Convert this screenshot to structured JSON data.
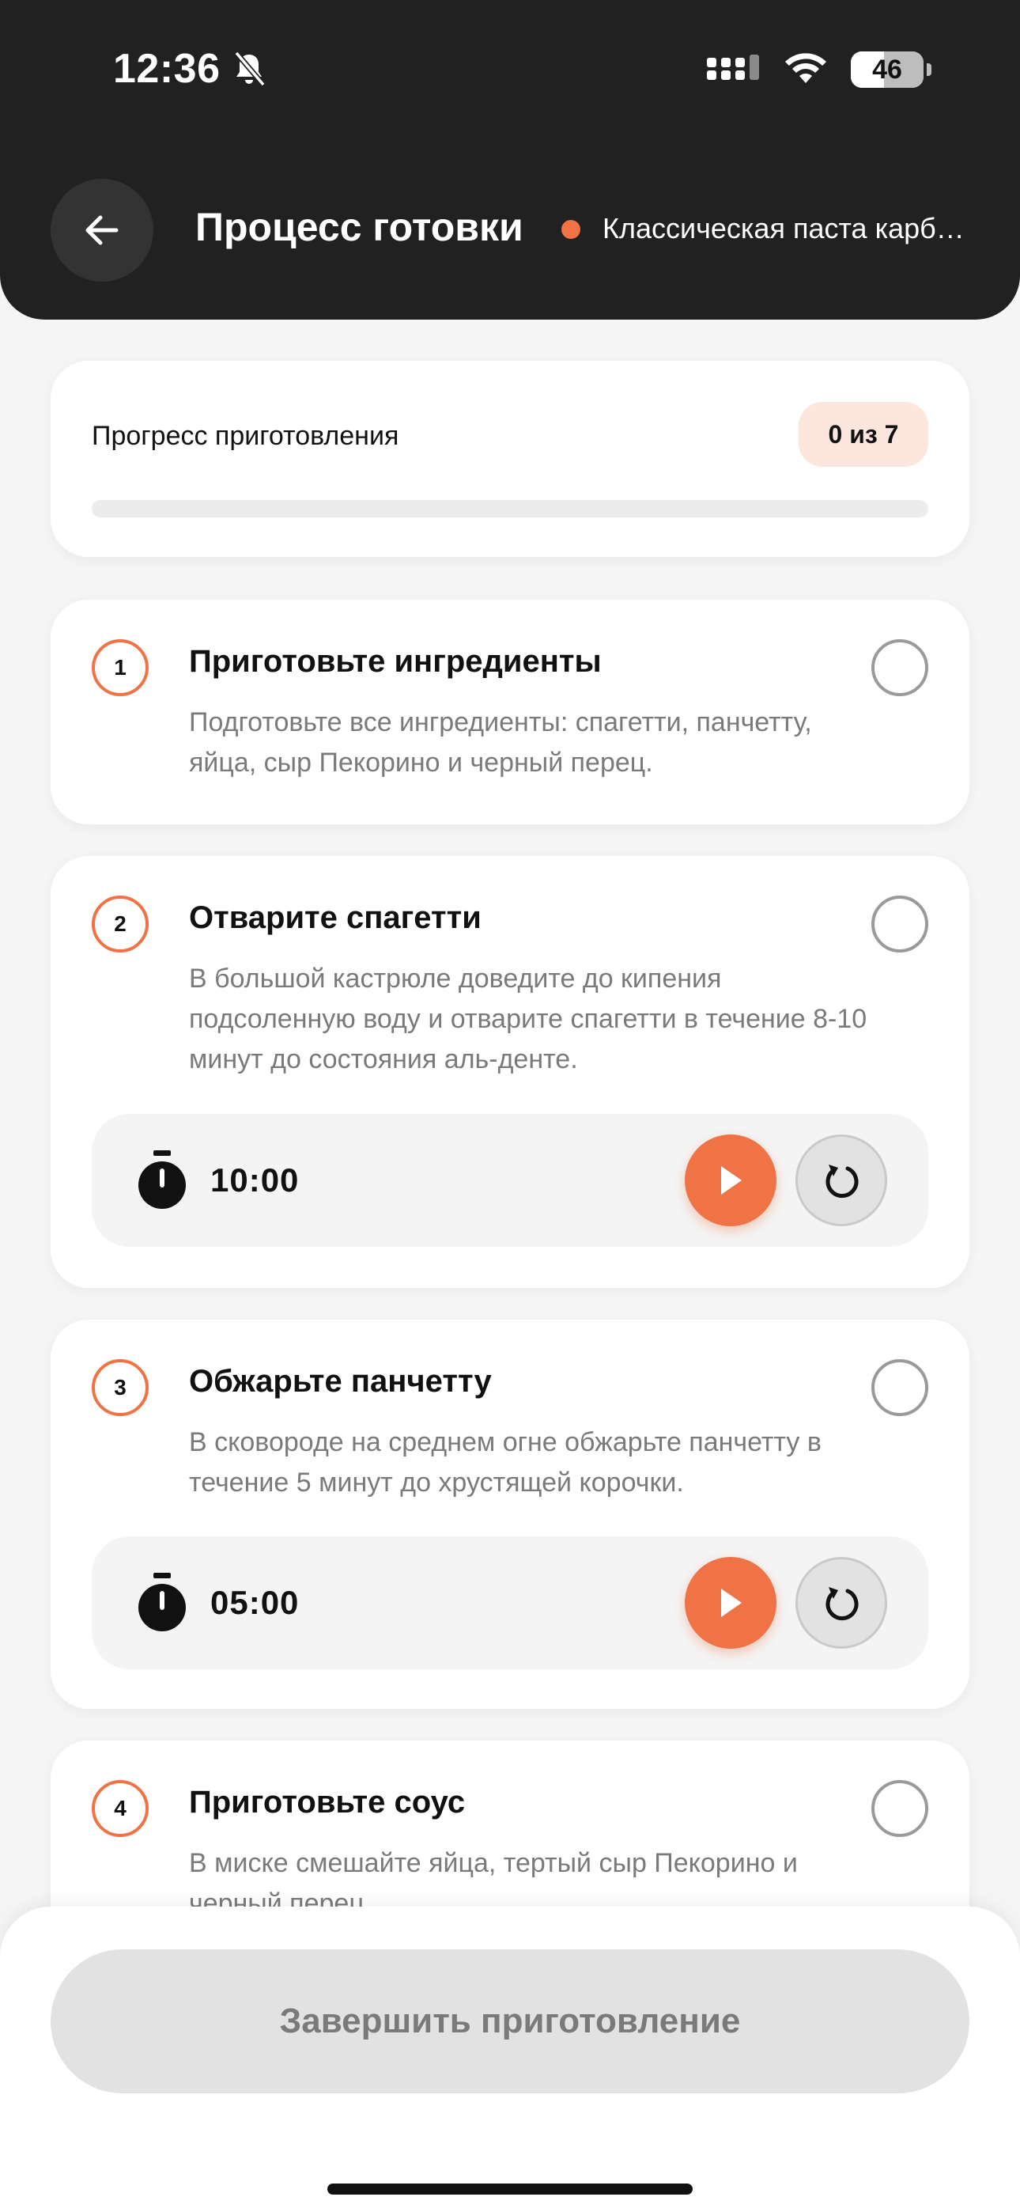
{
  "status_bar": {
    "time": "12:36",
    "battery": "46"
  },
  "header": {
    "title": "Процесс готовки",
    "recipe_name": "Классическая паста карбонара",
    "recipe_dot_color": "#f07346"
  },
  "progress": {
    "label": "Прогресс приготовления",
    "badge": "0 из 7",
    "completed": 0,
    "total": 7
  },
  "steps": [
    {
      "number": "1",
      "title": "Приготовьте ингредиенты",
      "description": "Подготовьте все ингредиенты: спагетти, панчетту, яйца, сыр Пекорино и черный перец."
    },
    {
      "number": "2",
      "title": "Отварите спагетти",
      "description": "В большой кастрюле доведите до кипения подсоленную воду и отварите спагетти в течение 8-10 минут до состояния аль-денте.",
      "timer": "10:00"
    },
    {
      "number": "3",
      "title": "Обжарьте панчетту",
      "description": "В сковороде на среднем огне обжарьте панчетту в течение 5 минут до хрустящей корочки.",
      "timer": "05:00"
    },
    {
      "number": "4",
      "title": "Приготовьте соус",
      "description": "В миске смешайте яйца, тертый сыр Пекорино и черный перец."
    }
  ],
  "footer": {
    "finish_label": "Завершить приготовление"
  },
  "colors": {
    "accent": "#f07346",
    "header_bg": "#212121",
    "page_bg": "#f5f5f5"
  }
}
